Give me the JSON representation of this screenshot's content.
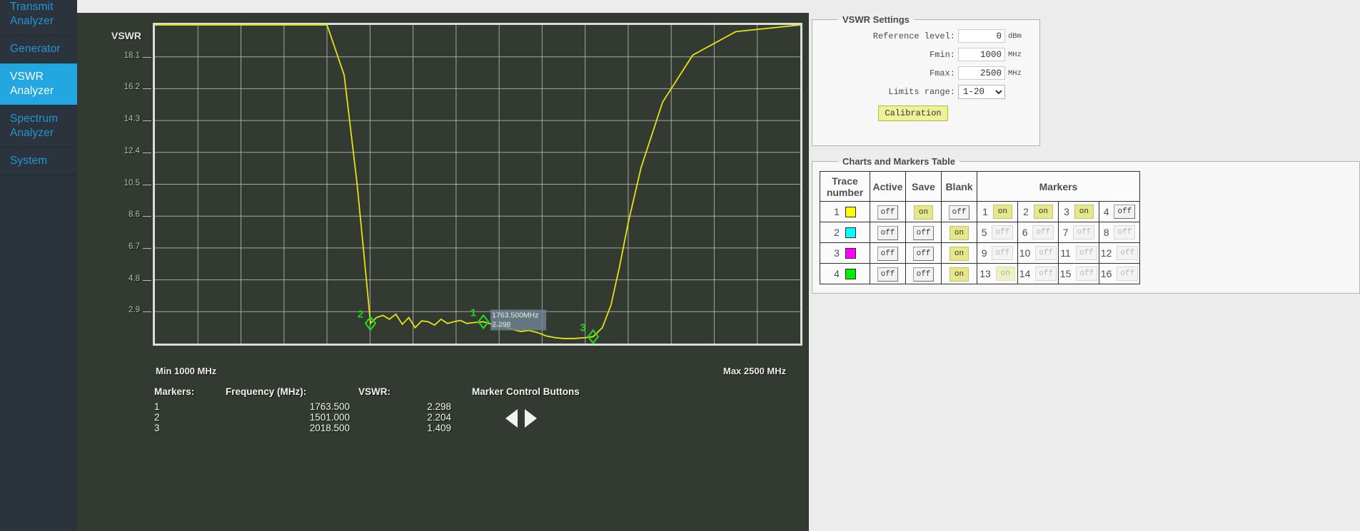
{
  "sidebar": {
    "items": [
      {
        "label": "Transmit Analyzer",
        "active": false
      },
      {
        "label": "Generator",
        "active": false
      },
      {
        "label": "VSWR Analyzer",
        "active": true
      },
      {
        "label": "Spectrum Analyzer",
        "active": false
      },
      {
        "label": "System",
        "active": false
      }
    ]
  },
  "chart_panel": {
    "title": "VSWR",
    "min_label": "Min 1000 MHz",
    "max_label": "Max 2500 MHz",
    "marker_control_title": "Marker Control Buttons",
    "prev_icon": "triangle-left-icon",
    "next_icon": "triangle-right-icon",
    "readout": {
      "headers": [
        "Markers:",
        "Frequency (MHz):",
        "VSWR:"
      ],
      "rows": [
        {
          "marker": "1",
          "frequency": "1763.500",
          "vswr": "2.298"
        },
        {
          "marker": "2",
          "frequency": "1501.000",
          "vswr": "2.204"
        },
        {
          "marker": "3",
          "frequency": "2018.500",
          "vswr": "1.409"
        }
      ]
    },
    "tooltip": {
      "freq": "1763.500MHz",
      "value": "2.298"
    }
  },
  "chart_data": {
    "type": "line",
    "title": "VSWR",
    "xlabel": "Frequency (MHz)",
    "ylabel": "VSWR",
    "xlim": [
      1000,
      2500
    ],
    "ylim": [
      1.0,
      20.0
    ],
    "grid": true,
    "legend": "none",
    "yticks": [
      18.1,
      16.2,
      14.3,
      12.4,
      10.5,
      8.6,
      6.7,
      4.8,
      2.9
    ],
    "ytick_labels": [
      "18.1",
      "16.2",
      "14.3",
      "12.4",
      "10.5",
      "8.6",
      "6.7",
      "4.8",
      "2.9"
    ],
    "xticks": [
      1000,
      1100,
      1200,
      1300,
      1400,
      1500,
      1600,
      1700,
      1800,
      1900,
      2000,
      2100,
      2200,
      2300,
      2400,
      2500
    ],
    "series": [
      {
        "name": "Trace 1",
        "color": "#e8e116",
        "x": [
          1000,
          1080,
          1160,
          1240,
          1320,
          1400,
          1440,
          1470,
          1490,
          1501,
          1515,
          1530,
          1545,
          1560,
          1575,
          1590,
          1605,
          1620,
          1635,
          1650,
          1665,
          1680,
          1695,
          1710,
          1725,
          1740,
          1763.5,
          1790,
          1810,
          1830,
          1850,
          1870,
          1890,
          1910,
          1930,
          1950,
          1975,
          2000,
          2018.5,
          2040,
          2060,
          2080,
          2100,
          2130,
          2180,
          2250,
          2350,
          2500
        ],
        "y": [
          20.0,
          20.0,
          20.0,
          20.0,
          20.0,
          20.0,
          17.0,
          10.5,
          5.2,
          2.204,
          2.55,
          2.68,
          2.45,
          2.75,
          2.15,
          2.55,
          1.95,
          2.35,
          2.3,
          2.1,
          2.45,
          2.2,
          2.3,
          2.38,
          2.2,
          2.25,
          2.298,
          2.1,
          2.05,
          1.85,
          1.72,
          1.78,
          1.65,
          1.45,
          1.35,
          1.3,
          1.3,
          1.35,
          1.409,
          1.95,
          3.3,
          5.6,
          8.2,
          11.5,
          15.4,
          18.2,
          19.6,
          20.0
        ]
      }
    ],
    "markers": [
      {
        "id": "1",
        "frequency": 1763.5,
        "vswr": 2.298,
        "color": "#21d421"
      },
      {
        "id": "2",
        "frequency": 1501.0,
        "vswr": 2.204,
        "color": "#21d421"
      },
      {
        "id": "3",
        "frequency": 2018.5,
        "vswr": 1.409,
        "color": "#21d421"
      }
    ]
  },
  "settings": {
    "legend": "VSWR Settings",
    "reference_level": {
      "label": "Reference level:",
      "value": "0",
      "unit": "dBm"
    },
    "fmin": {
      "label": "Fmin:",
      "value": "1000",
      "unit": "MHz"
    },
    "fmax": {
      "label": "Fmax:",
      "value": "2500",
      "unit": "MHz"
    },
    "limits_range": {
      "label": "Limits range:",
      "value": "1-20",
      "options": [
        "1-20"
      ]
    },
    "calibration_label": "Calibration"
  },
  "markers_table": {
    "legend": "Charts and Markers Table",
    "headers": {
      "trace": "Trace number",
      "active": "Active",
      "save": "Save",
      "blank": "Blank",
      "markers": "Markers"
    },
    "rows": [
      {
        "trace": "1",
        "color": "#ffff00",
        "active": {
          "label": "off",
          "state": "off"
        },
        "save": {
          "label": "on",
          "state": "on"
        },
        "blank": {
          "label": "off",
          "state": "off"
        },
        "markers": [
          {
            "num": "1",
            "label": "on",
            "state": "on"
          },
          {
            "num": "2",
            "label": "on",
            "state": "on"
          },
          {
            "num": "3",
            "label": "on",
            "state": "on"
          },
          {
            "num": "4",
            "label": "off",
            "state": "off"
          }
        ]
      },
      {
        "trace": "2",
        "color": "#00ffff",
        "active": {
          "label": "off",
          "state": "off"
        },
        "save": {
          "label": "off",
          "state": "off"
        },
        "blank": {
          "label": "on",
          "state": "on"
        },
        "markers": [
          {
            "num": "5",
            "label": "off",
            "state": "disabled-off"
          },
          {
            "num": "6",
            "label": "off",
            "state": "disabled-off"
          },
          {
            "num": "7",
            "label": "off",
            "state": "disabled-off"
          },
          {
            "num": "8",
            "label": "off",
            "state": "disabled-off"
          }
        ]
      },
      {
        "trace": "3",
        "color": "#ff00ff",
        "active": {
          "label": "off",
          "state": "off"
        },
        "save": {
          "label": "off",
          "state": "off"
        },
        "blank": {
          "label": "on",
          "state": "on"
        },
        "markers": [
          {
            "num": "9",
            "label": "off",
            "state": "disabled-off"
          },
          {
            "num": "10",
            "label": "off",
            "state": "disabled-off"
          },
          {
            "num": "11",
            "label": "off",
            "state": "disabled-off"
          },
          {
            "num": "12",
            "label": "off",
            "state": "disabled-off"
          }
        ]
      },
      {
        "trace": "4",
        "color": "#00ee00",
        "active": {
          "label": "off",
          "state": "off"
        },
        "save": {
          "label": "off",
          "state": "off"
        },
        "blank": {
          "label": "on",
          "state": "on"
        },
        "markers": [
          {
            "num": "13",
            "label": "on",
            "state": "disabled-on"
          },
          {
            "num": "14",
            "label": "off",
            "state": "disabled-off"
          },
          {
            "num": "15",
            "label": "off",
            "state": "disabled-off"
          },
          {
            "num": "16",
            "label": "off",
            "state": "disabled-off"
          }
        ]
      }
    ]
  }
}
